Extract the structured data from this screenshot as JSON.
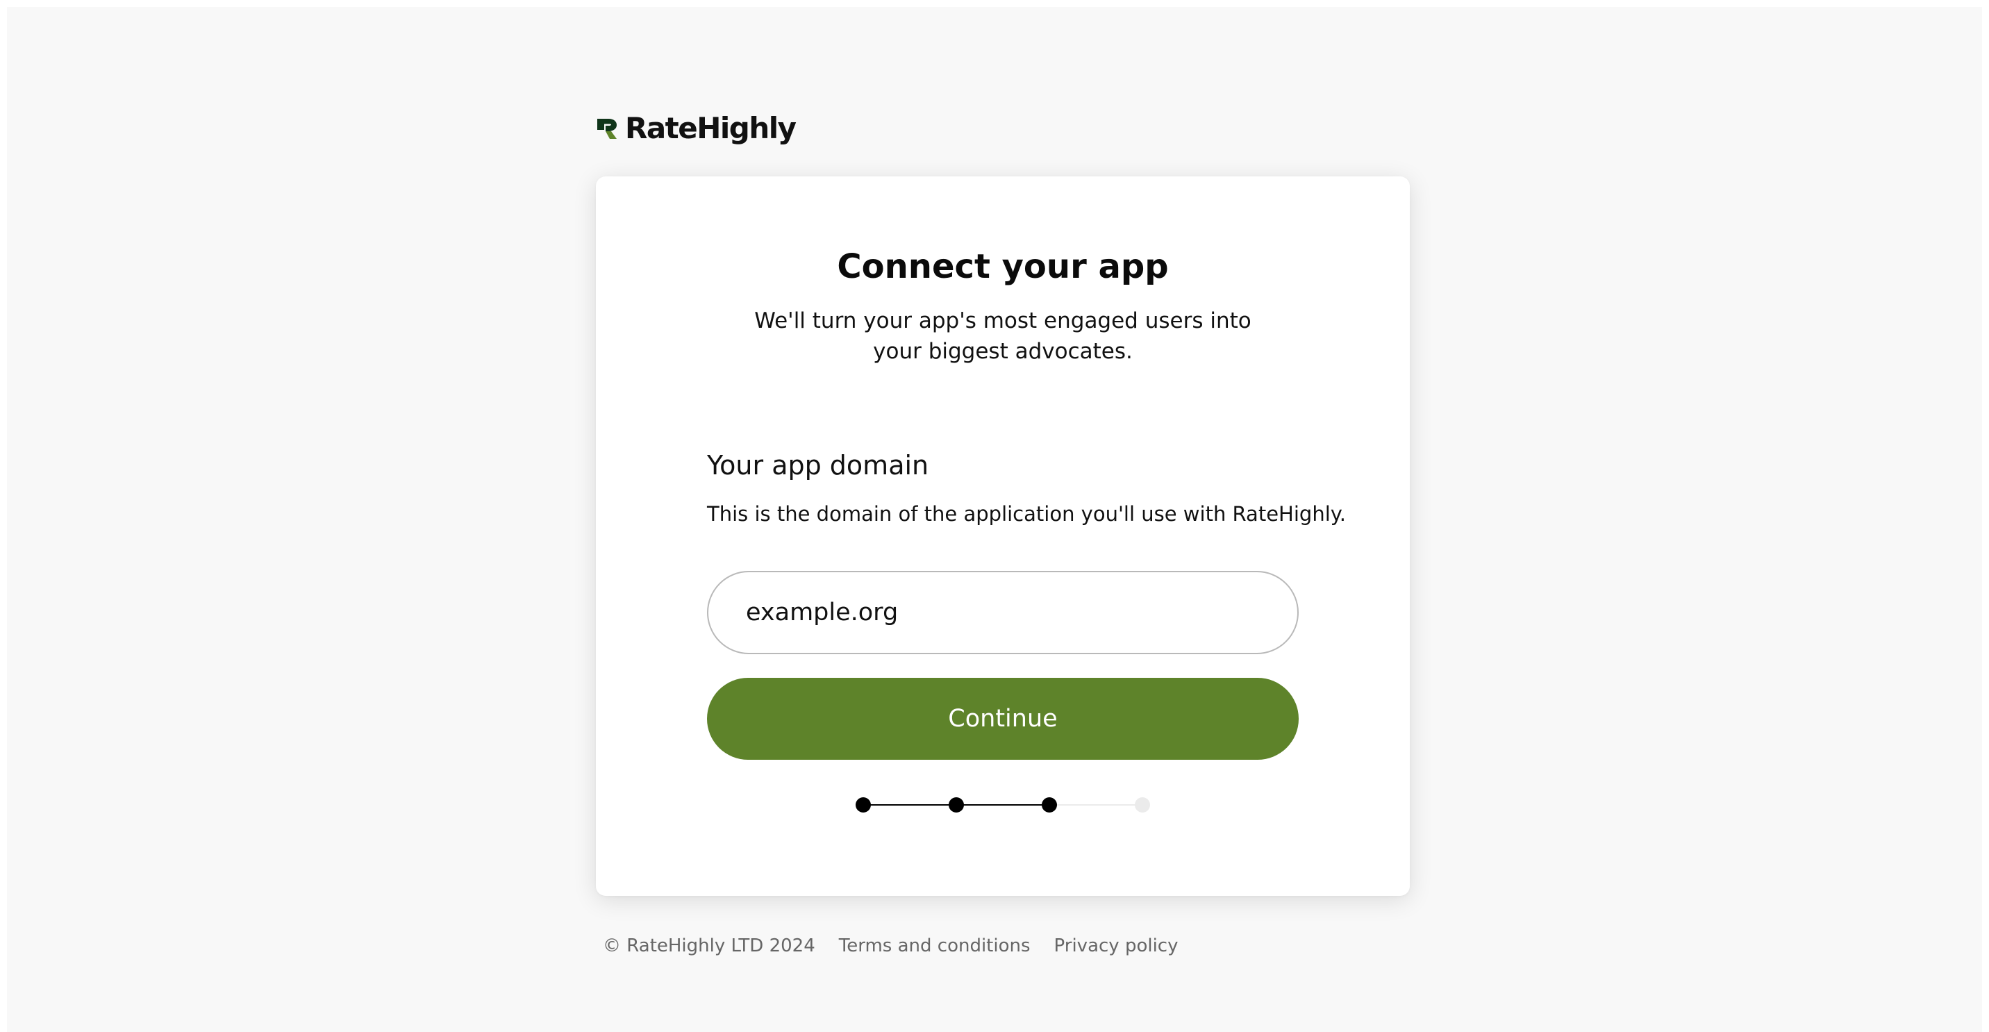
{
  "brand": {
    "name": "RateHighly",
    "logo_icon": "ratehighly-logo-mark-icon",
    "color_dark": "#10351a",
    "color_green": "#5e832a"
  },
  "card": {
    "title": "Connect your app",
    "subtitle": "We'll turn your app's most engaged users into your biggest advocates.",
    "field_label": "Your app domain",
    "field_help": "This is the domain of the application you'll use with RateHighly.",
    "domain_value": "example.org",
    "continue_label": "Continue"
  },
  "progress": {
    "total_steps": 4,
    "completed_steps": 3,
    "active_color": "#000000",
    "inactive_color": "#ebebeb"
  },
  "footer": {
    "copyright": "© RateHighly LTD 2024",
    "terms": "Terms and conditions",
    "privacy": "Privacy policy"
  },
  "colors": {
    "page_background": "#f8f8f8",
    "card_background": "#ffffff",
    "button_background": "#5e832a",
    "button_text": "#ffffff"
  }
}
